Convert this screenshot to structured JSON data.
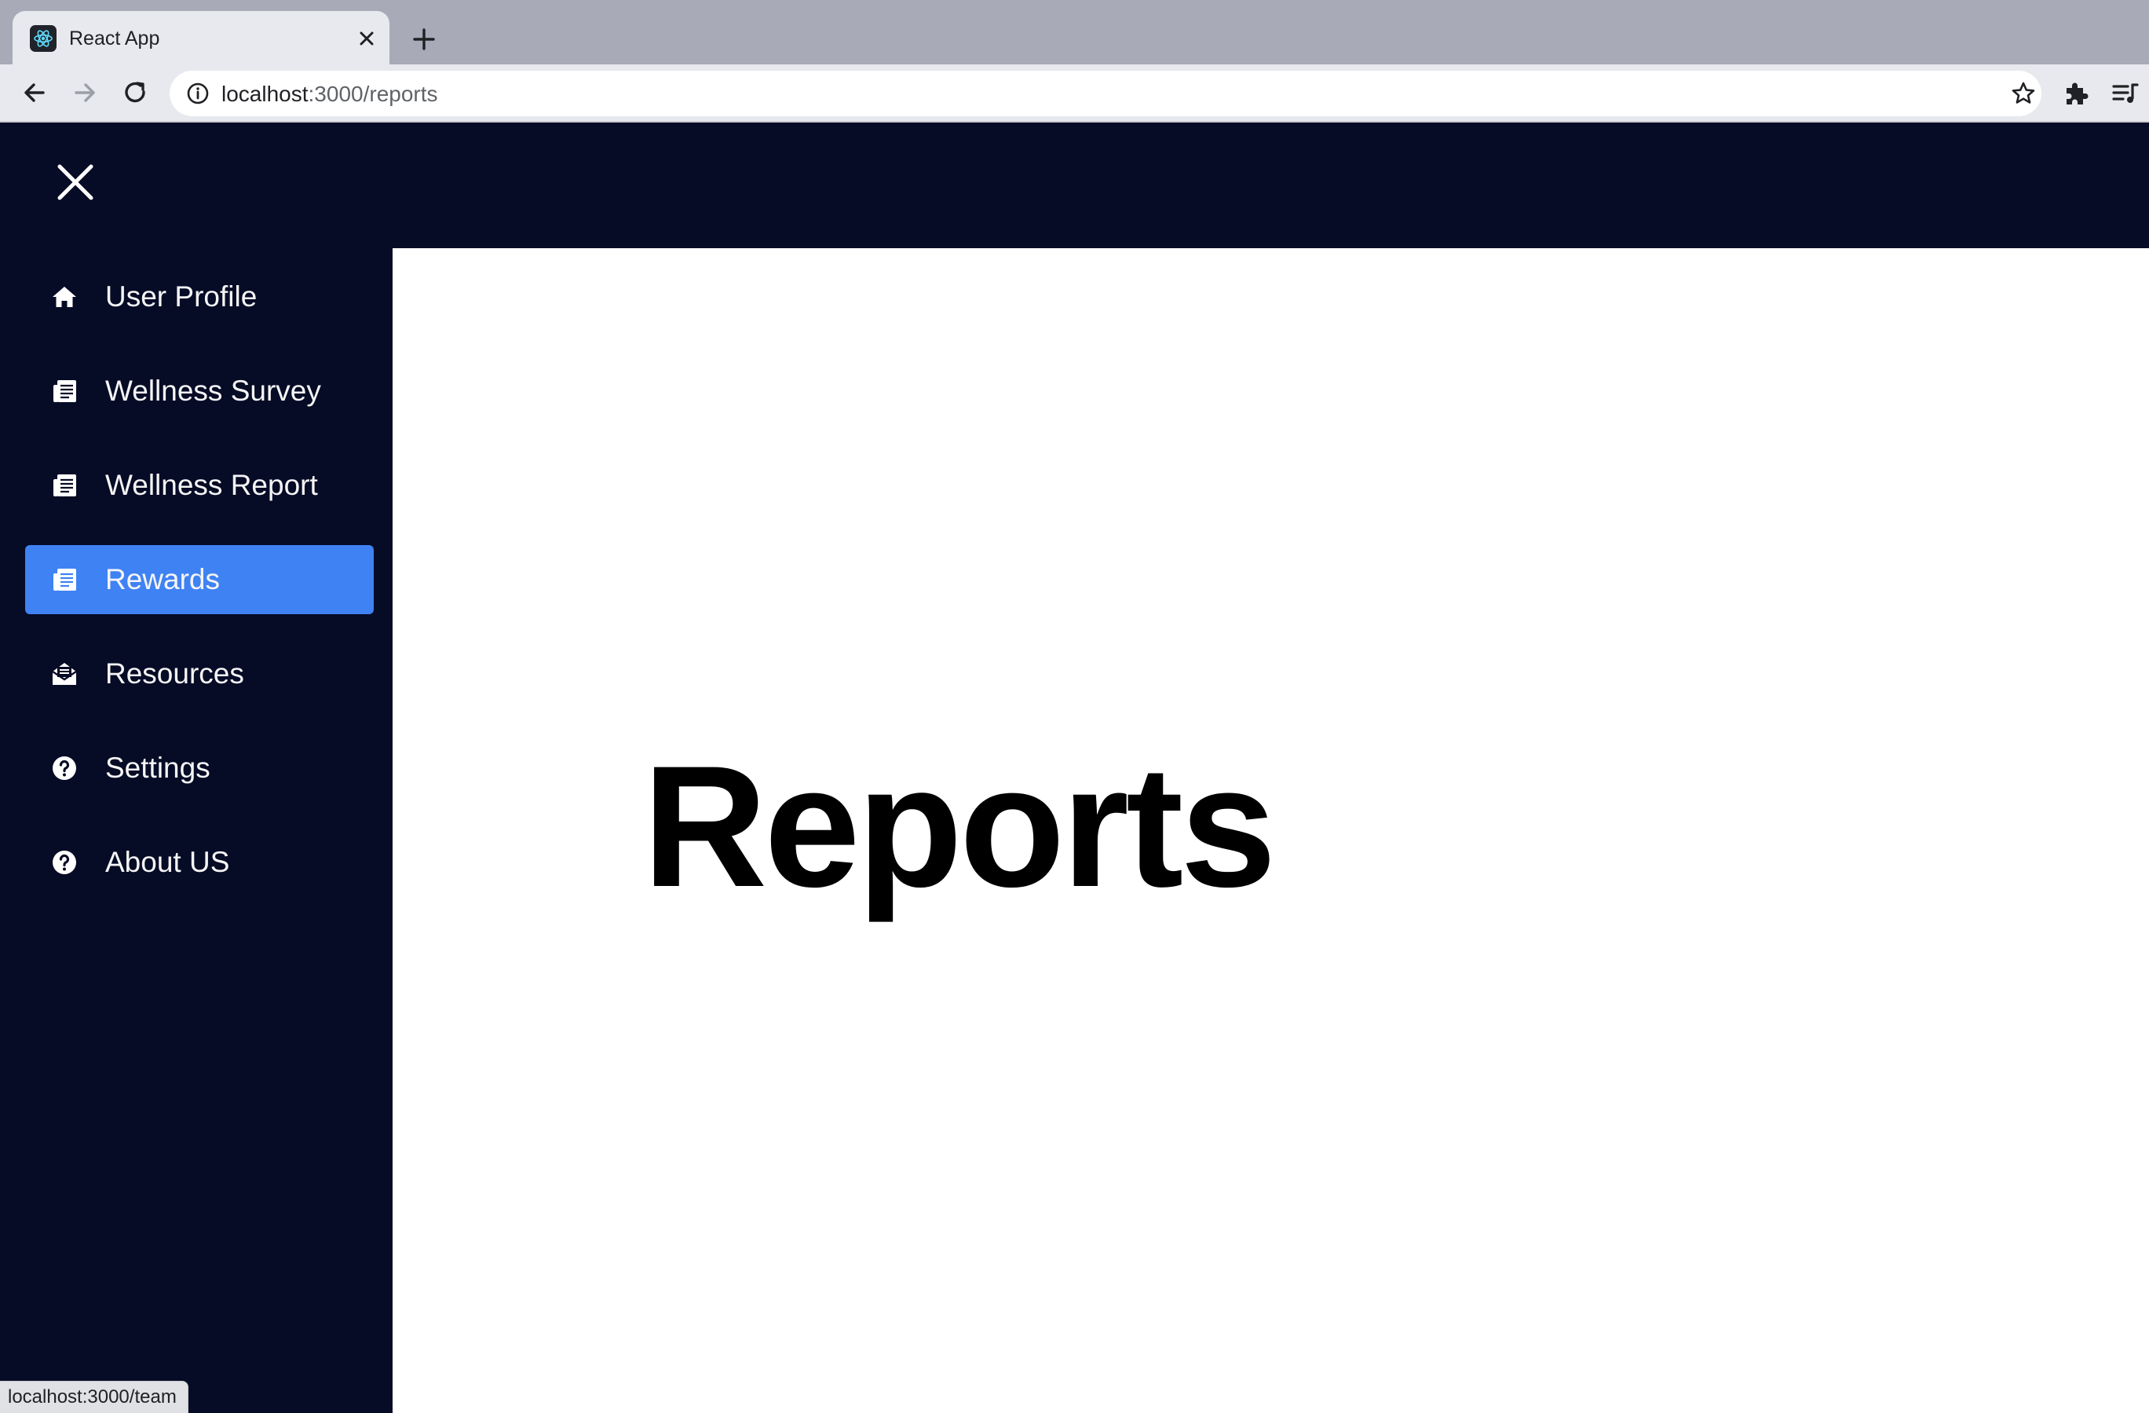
{
  "browser": {
    "tab_title": "React App",
    "url_host": "localhost",
    "url_path": ":3000/reports",
    "status_url": "localhost:3000/team"
  },
  "sidebar": {
    "items": [
      {
        "label": "User Profile",
        "icon": "home-icon",
        "active": false
      },
      {
        "label": "Wellness Survey",
        "icon": "document-icon",
        "active": false
      },
      {
        "label": "Wellness Report",
        "icon": "document-icon",
        "active": false
      },
      {
        "label": "Rewards",
        "icon": "document-icon",
        "active": true
      },
      {
        "label": "Resources",
        "icon": "envelope-open-icon",
        "active": false
      },
      {
        "label": "Settings",
        "icon": "question-circle-icon",
        "active": false
      },
      {
        "label": "About US",
        "icon": "question-circle-icon",
        "active": false
      }
    ]
  },
  "main": {
    "title": "Reports"
  },
  "colors": {
    "nav_background": "#060b26",
    "active_item": "#3f82f4",
    "browser_tabstrip": "#a8aab8"
  }
}
